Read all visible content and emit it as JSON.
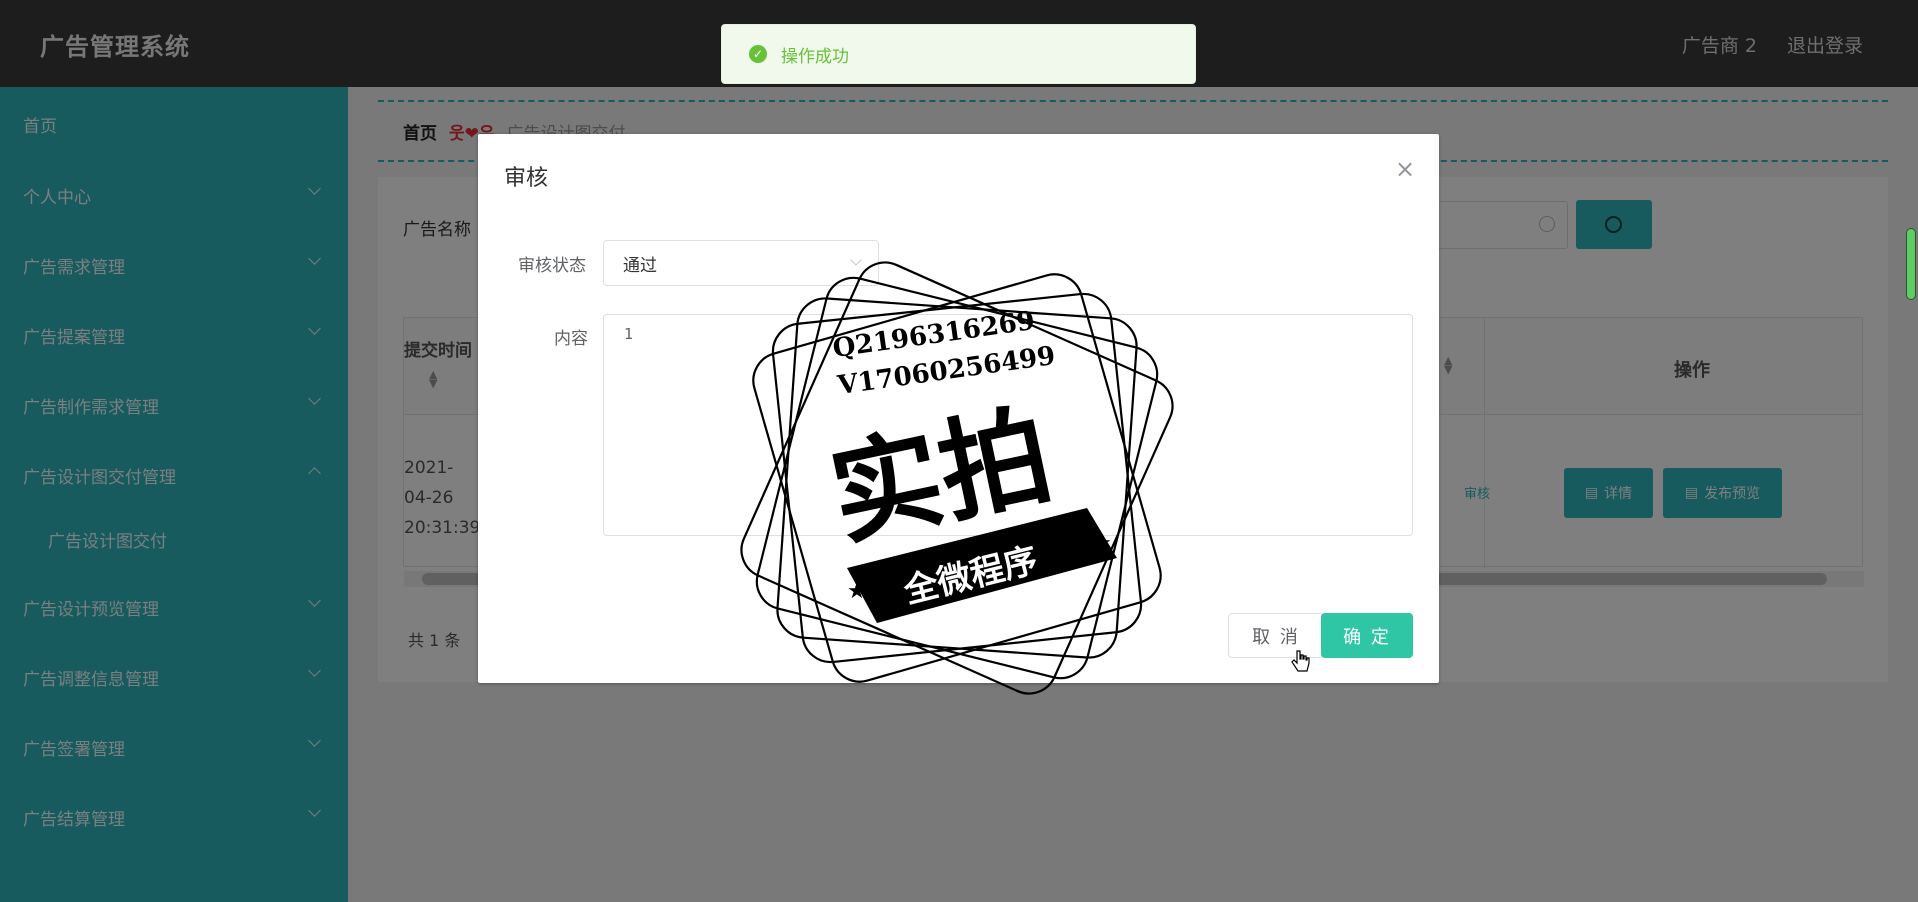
{
  "header": {
    "app_title": "广告管理系统",
    "user": "广告商 2",
    "logout": "退出登录"
  },
  "sidebar": {
    "items": [
      {
        "label": "首页"
      },
      {
        "label": "个人中心"
      },
      {
        "label": "广告需求管理"
      },
      {
        "label": "广告提案管理"
      },
      {
        "label": "广告制作需求管理"
      },
      {
        "label": "广告设计图交付管理"
      },
      {
        "label": "广告设计图交付"
      },
      {
        "label": "广告设计预览管理"
      },
      {
        "label": "广告调整信息管理"
      },
      {
        "label": "广告签署管理"
      },
      {
        "label": "广告结算管理"
      }
    ]
  },
  "breadcrumb": {
    "home": "首页",
    "separator": "웃❤유",
    "current": "广告设计图交付"
  },
  "search": {
    "label": "广告名称"
  },
  "table": {
    "col_submit_time": "提交时间",
    "col_operation": "操作",
    "rows": [
      {
        "submit_time": "2021-04-26 20:31:39",
        "audit_link": "审核",
        "btn_detail": "详情",
        "btn_preview": "发布预览"
      }
    ]
  },
  "pagination": {
    "total": "共 1 条"
  },
  "toast": {
    "message": "操作成功"
  },
  "dialog": {
    "title": "审核",
    "status_label": "审核状态",
    "status_value": "通过",
    "content_label": "内容",
    "content_value": "1",
    "cancel": "取 消",
    "confirm": "确 定"
  },
  "watermark": {
    "line1": "Q2196316269",
    "line2": "V17060256499",
    "big": "实拍",
    "banner": "全微程序"
  },
  "colors": {
    "accent": "#2eb6be",
    "confirm": "#2fc6a6",
    "success": "#67c23a",
    "header_bg": "#3a3a3a"
  }
}
